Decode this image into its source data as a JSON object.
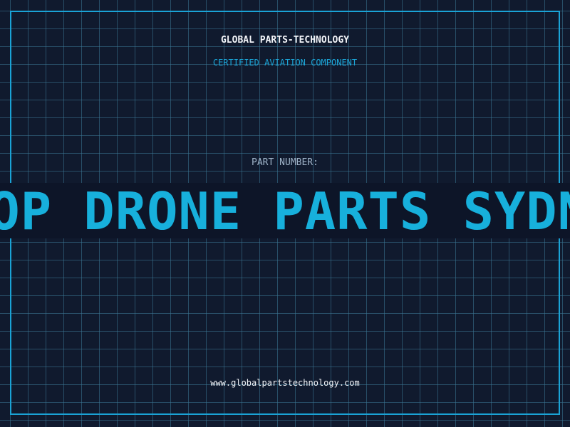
{
  "header": {
    "brand": "GLOBAL PARTS-TECHNOLOGY",
    "subtitle": "CERTIFIED AVIATION COMPONENT"
  },
  "part": {
    "label": "PART NUMBER:",
    "value": "TOP DRONE PARTS SYDNEY"
  },
  "footer": {
    "website": "www.globalpartstechnology.com"
  },
  "colors": {
    "background": "#101a2e",
    "grid": "#3c7896",
    "accent": "#1aa3d6",
    "text": "#f2f4f8",
    "muted": "#9fb3c8"
  }
}
